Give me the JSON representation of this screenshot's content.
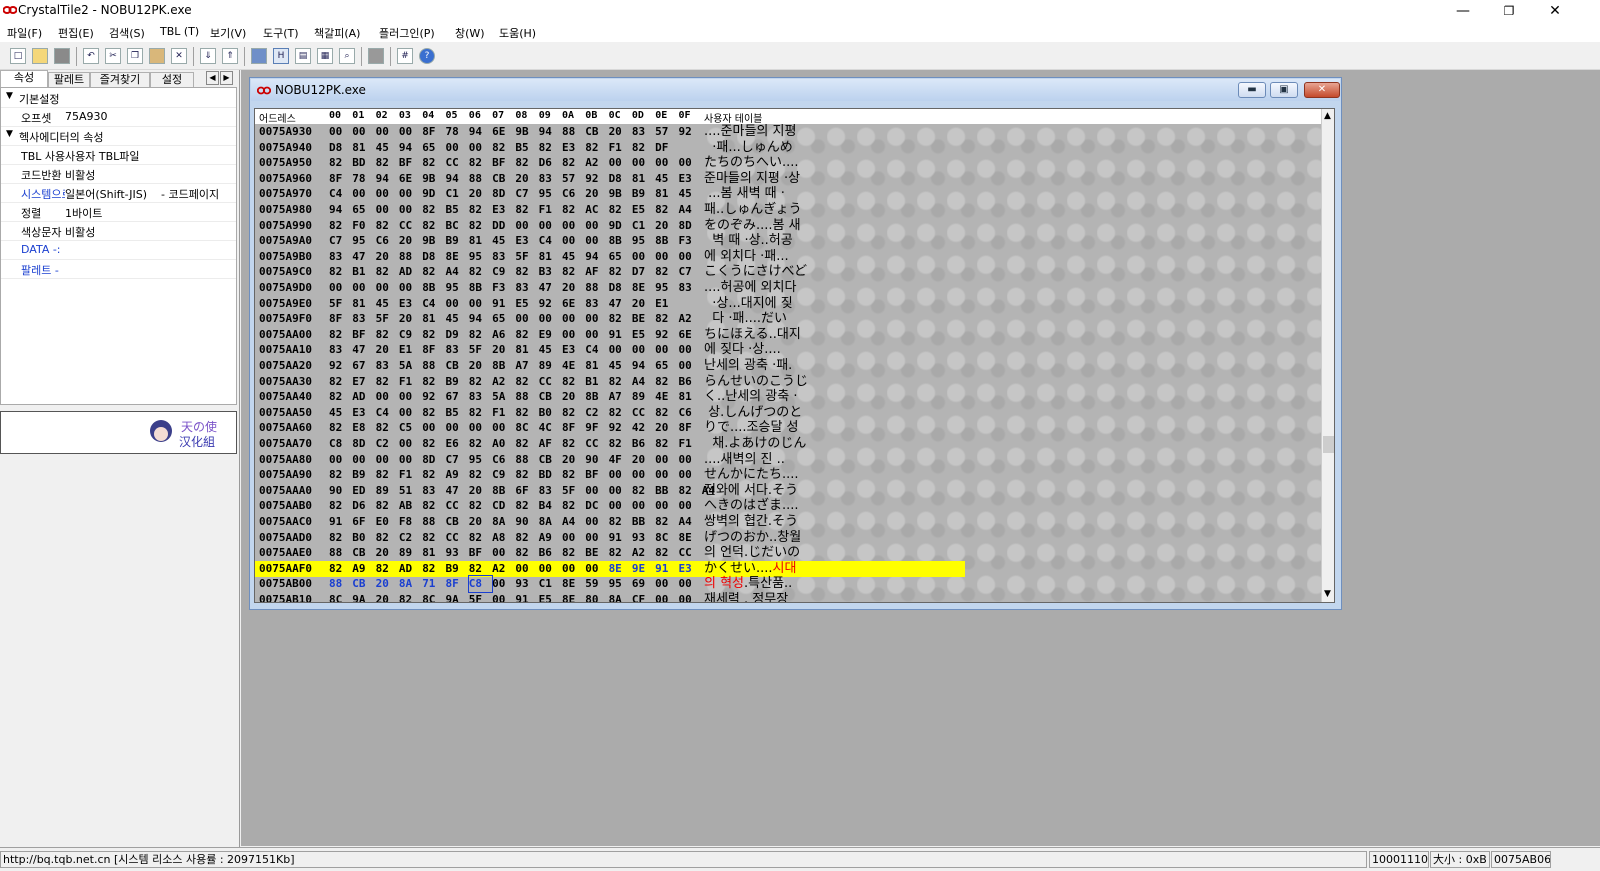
{
  "window": {
    "title": "CrystalTile2 - NOBU12PK.exe",
    "min_icon": "minimize-icon",
    "max_icon": "restore-icon",
    "close_icon": "close-icon"
  },
  "menu": [
    "파일(F)",
    "편집(E)",
    "검색(S)",
    "TBL (T)",
    "보기(V)",
    "도구(T)",
    "책갈피(A)",
    "플러그인(P)",
    "창(W)",
    "도움(H)"
  ],
  "toolbar": {
    "icons": [
      "new-file-icon",
      "open-folder-icon",
      "save-icon",
      "undo-icon",
      "cut-icon",
      "copy-icon",
      "paste-icon",
      "delete-icon",
      "import-icon",
      "export-icon",
      "hex-view-icon",
      "tile-view-icon",
      "text-view-icon",
      "palette-icon",
      "search-icon",
      "print-icon",
      "grid-icon",
      "help-icon"
    ]
  },
  "left_panel": {
    "tabs": [
      "속성",
      "팔레트",
      "즐겨찾기",
      "설정"
    ],
    "sections": [
      {
        "title": "기본설정",
        "rows": [
          {
            "name": "오프셋",
            "value": "75A930",
            "link": false
          }
        ]
      },
      {
        "title": "헥사에디터의 속성",
        "rows": [
          {
            "name": "TBL 사용",
            "value": "사용자 TBL파일",
            "link": false
          },
          {
            "name": "코드반환",
            "value": "비활성",
            "link": false
          },
          {
            "name": "시스템으로",
            "value": "일본어(Shift-JIS)",
            "value2": "- 코드페이지",
            "link": true
          },
          {
            "name": "정렬",
            "value": "1바이트",
            "link": false
          },
          {
            "name": "색상문자",
            "value": "비활성",
            "link": false
          },
          {
            "name": "DATA -:",
            "value": "",
            "link": true
          },
          {
            "name": "팔레트 -",
            "value": "",
            "link": true
          }
        ]
      }
    ],
    "logo_text": "天の使 汉化组"
  },
  "child_window": {
    "title": "NOBU12PK.exe",
    "header": {
      "address": "어드레스",
      "columns": [
        "00",
        "01",
        "02",
        "03",
        "04",
        "05",
        "06",
        "07",
        "08",
        "09",
        "0A",
        "0B",
        "0C",
        "0D",
        "0E",
        "0F"
      ],
      "text": "사용자 테이블"
    },
    "rows": [
      {
        "addr": "0075A930",
        "bytes": [
          "00",
          "00",
          "00",
          "00",
          "8F",
          "78",
          "94",
          "6E",
          "9B",
          "94",
          "88",
          "CB",
          "20",
          "83",
          "57",
          "92"
        ],
        "text": "....준마들의 지평"
      },
      {
        "addr": "0075A940",
        "bytes": [
          "D8",
          "81",
          "45",
          "94",
          "65",
          "00",
          "00",
          "82",
          "B5",
          "82",
          "E3",
          "82",
          "F1",
          "82",
          "DF"
        ],
        "text": "  ·패...しゅんめ"
      },
      {
        "addr": "0075A950",
        "bytes": [
          "82",
          "BD",
          "82",
          "BF",
          "82",
          "CC",
          "82",
          "BF",
          "82",
          "D6",
          "82",
          "A2",
          "00",
          "00",
          "00",
          "00"
        ],
        "text": "たちのちへい...."
      },
      {
        "addr": "0075A960",
        "bytes": [
          "8F",
          "78",
          "94",
          "6E",
          "9B",
          "94",
          "88",
          "CB",
          "20",
          "83",
          "57",
          "92",
          "D8",
          "81",
          "45",
          "E3"
        ],
        "text": "준마들의 지평 ·상"
      },
      {
        "addr": "0075A970",
        "bytes": [
          "C4",
          "00",
          "00",
          "00",
          "9D",
          "C1",
          "20",
          "8D",
          "C7",
          "95",
          "C6",
          "20",
          "9B",
          "B9",
          "81",
          "45"
        ],
        "text": " ...봄 새벽 때 ·"
      },
      {
        "addr": "0075A980",
        "bytes": [
          "94",
          "65",
          "00",
          "00",
          "82",
          "B5",
          "82",
          "E3",
          "82",
          "F1",
          "82",
          "AC",
          "82",
          "E5",
          "82",
          "A4"
        ],
        "text": "패..しゅんぎょう"
      },
      {
        "addr": "0075A990",
        "bytes": [
          "82",
          "F0",
          "82",
          "CC",
          "82",
          "BC",
          "82",
          "DD",
          "00",
          "00",
          "00",
          "00",
          "9D",
          "C1",
          "20",
          "8D"
        ],
        "text": "をのぞみ....봄 새"
      },
      {
        "addr": "0075A9A0",
        "bytes": [
          "C7",
          "95",
          "C6",
          "20",
          "9B",
          "B9",
          "81",
          "45",
          "E3",
          "C4",
          "00",
          "00",
          "8B",
          "95",
          "8B",
          "F3"
        ],
        "text": "  벽 때 ·상..허공"
      },
      {
        "addr": "0075A9B0",
        "bytes": [
          "83",
          "47",
          "20",
          "88",
          "D8",
          "8E",
          "95",
          "83",
          "5F",
          "81",
          "45",
          "94",
          "65",
          "00",
          "00",
          "00"
        ],
        "text": "에 외치다 ·패..."
      },
      {
        "addr": "0075A9C0",
        "bytes": [
          "82",
          "B1",
          "82",
          "AD",
          "82",
          "A4",
          "82",
          "C9",
          "82",
          "B3",
          "82",
          "AF",
          "82",
          "D7",
          "82",
          "C7"
        ],
        "text": "こくうにさけべど"
      },
      {
        "addr": "0075A9D0",
        "bytes": [
          "00",
          "00",
          "00",
          "00",
          "8B",
          "95",
          "8B",
          "F3",
          "83",
          "47",
          "20",
          "88",
          "D8",
          "8E",
          "95",
          "83"
        ],
        "text": "....허공에 외치다"
      },
      {
        "addr": "0075A9E0",
        "bytes": [
          "5F",
          "81",
          "45",
          "E3",
          "C4",
          "00",
          "00",
          "91",
          "E5",
          "92",
          "6E",
          "83",
          "47",
          "20",
          "E1"
        ],
        "text": "  ·상...대지에 짖"
      },
      {
        "addr": "0075A9F0",
        "bytes": [
          "8F",
          "83",
          "5F",
          "20",
          "81",
          "45",
          "94",
          "65",
          "00",
          "00",
          "00",
          "00",
          "82",
          "BE",
          "82",
          "A2"
        ],
        "text": "  다 ·패....だい"
      },
      {
        "addr": "0075AA00",
        "bytes": [
          "82",
          "BF",
          "82",
          "C9",
          "82",
          "D9",
          "82",
          "A6",
          "82",
          "E9",
          "00",
          "00",
          "91",
          "E5",
          "92",
          "6E"
        ],
        "text": "ちにほえる..대지"
      },
      {
        "addr": "0075AA10",
        "bytes": [
          "83",
          "47",
          "20",
          "E1",
          "8F",
          "83",
          "5F",
          "20",
          "81",
          "45",
          "E3",
          "C4",
          "00",
          "00",
          "00",
          "00"
        ],
        "text": "에 짖다 ·상...."
      },
      {
        "addr": "0075AA20",
        "bytes": [
          "92",
          "67",
          "83",
          "5A",
          "88",
          "CB",
          "20",
          "8B",
          "A7",
          "89",
          "4E",
          "81",
          "45",
          "94",
          "65",
          "00"
        ],
        "text": "난세의 광축 ·패."
      },
      {
        "addr": "0075AA30",
        "bytes": [
          "82",
          "E7",
          "82",
          "F1",
          "82",
          "B9",
          "82",
          "A2",
          "82",
          "CC",
          "82",
          "B1",
          "82",
          "A4",
          "82",
          "B6"
        ],
        "text": "らんせいのこうじ"
      },
      {
        "addr": "0075AA40",
        "bytes": [
          "82",
          "AD",
          "00",
          "00",
          "92",
          "67",
          "83",
          "5A",
          "88",
          "CB",
          "20",
          "8B",
          "A7",
          "89",
          "4E",
          "81"
        ],
        "text": "く..난세의 광축 ·"
      },
      {
        "addr": "0075AA50",
        "bytes": [
          "45",
          "E3",
          "C4",
          "00",
          "82",
          "B5",
          "82",
          "F1",
          "82",
          "B0",
          "82",
          "C2",
          "82",
          "CC",
          "82",
          "C6"
        ],
        "text": " 상.しんげつのと"
      },
      {
        "addr": "0075AA60",
        "bytes": [
          "82",
          "E8",
          "82",
          "C5",
          "00",
          "00",
          "00",
          "00",
          "8C",
          "4C",
          "8F",
          "9F",
          "92",
          "42",
          "20",
          "8F"
        ],
        "text": "りで....조승달 성"
      },
      {
        "addr": "0075AA70",
        "bytes": [
          "C8",
          "8D",
          "C2",
          "00",
          "82",
          "E6",
          "82",
          "A0",
          "82",
          "AF",
          "82",
          "CC",
          "82",
          "B6",
          "82",
          "F1"
        ],
        "text": "  채.よあけのじん"
      },
      {
        "addr": "0075AA80",
        "bytes": [
          "00",
          "00",
          "00",
          "00",
          "8D",
          "C7",
          "95",
          "C6",
          "88",
          "CB",
          "20",
          "90",
          "4F",
          "20",
          "00",
          "00"
        ],
        "text": "....새벽의 진 .."
      },
      {
        "addr": "0075AA90",
        "bytes": [
          "82",
          "B9",
          "82",
          "F1",
          "82",
          "A9",
          "82",
          "C9",
          "82",
          "BD",
          "82",
          "BF",
          "00",
          "00",
          "00",
          "00"
        ],
        "text": "せんかにたち...."
      },
      {
        "addr": "0075AAA0",
        "bytes": [
          "90",
          "ED",
          "89",
          "51",
          "83",
          "47",
          "20",
          "8B",
          "6F",
          "83",
          "5F",
          "00",
          "00",
          "82",
          "BB",
          "82",
          "A4"
        ],
        "text": "전와에 서다.そう"
      },
      {
        "addr": "0075AAB0",
        "bytes": [
          "82",
          "D6",
          "82",
          "AB",
          "82",
          "CC",
          "82",
          "CD",
          "82",
          "B4",
          "82",
          "DC",
          "00",
          "00",
          "00",
          "00"
        ],
        "text": "へきのはざま...."
      },
      {
        "addr": "0075AAC0",
        "bytes": [
          "91",
          "6F",
          "E0",
          "F8",
          "88",
          "CB",
          "20",
          "8A",
          "90",
          "8A",
          "A4",
          "00",
          "82",
          "BB",
          "82",
          "A4"
        ],
        "text": "쌍벽의 협간.そう"
      },
      {
        "addr": "0075AAD0",
        "bytes": [
          "82",
          "B0",
          "82",
          "C2",
          "82",
          "CC",
          "82",
          "A8",
          "82",
          "A9",
          "00",
          "00",
          "91",
          "93",
          "8C",
          "8E"
        ],
        "text": "げつのおか..창월"
      },
      {
        "addr": "0075AAE0",
        "bytes": [
          "88",
          "CB",
          "20",
          "89",
          "81",
          "93",
          "BF",
          "00",
          "82",
          "B6",
          "82",
          "BE",
          "82",
          "A2",
          "82",
          "CC"
        ],
        "text": "의 언덕.じだいの"
      },
      {
        "addr": "0075AAF0",
        "bytes": [
          "82",
          "A9",
          "82",
          "AD",
          "82",
          "B9",
          "82",
          "A2",
          "00",
          "00",
          "00",
          "00",
          "8E",
          "9E",
          "91",
          "E3"
        ],
        "text_plain": "かくせい....",
        "text_colored": "시대",
        "highlight": true
      },
      {
        "addr": "0075AB00",
        "bytes": [
          "88",
          "CB",
          "20",
          "8A",
          "71",
          "8F",
          "C8",
          "00",
          "93",
          "C1",
          "8E",
          "59",
          "95",
          "69",
          "00",
          "00"
        ],
        "text_colored": "의 혁성",
        "text_plain": ".특산품..",
        "partial_blue": true
      },
      {
        "addr": "0075AB10",
        "bytes": [
          "8C",
          "9A",
          "20",
          "82",
          "8C",
          "9A",
          "5F",
          "00",
          "91",
          "E5",
          "8E",
          "80",
          "8A",
          "CF",
          "00",
          "00"
        ],
        "text": "재세력 . 정무장"
      }
    ]
  },
  "status": {
    "message": "http://bq.tqb.net.cn [시스템 리소스 사용률 : 2097151Kb]",
    "code": "10001110",
    "size": "大小 : 0xB",
    "addr": "0075AB06"
  }
}
